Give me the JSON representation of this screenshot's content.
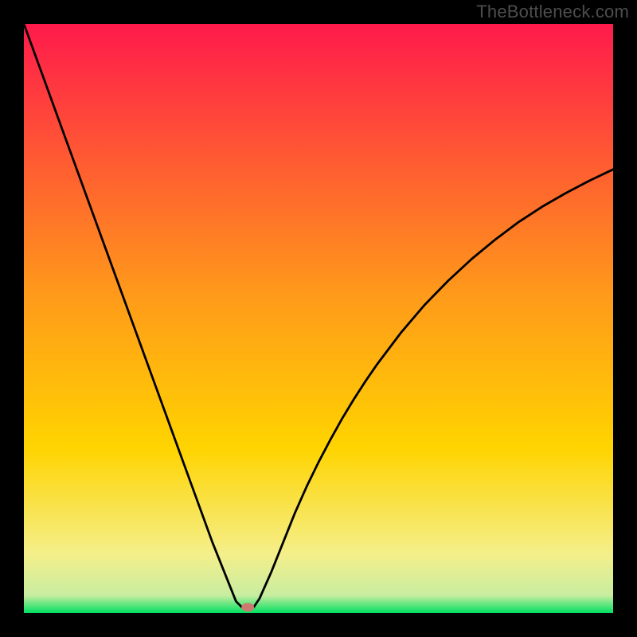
{
  "watermark": "TheBottleneck.com",
  "chart_data": {
    "type": "line",
    "title": "",
    "xlabel": "",
    "ylabel": "",
    "xlim": [
      0,
      100
    ],
    "ylim": [
      0,
      100
    ],
    "grid": false,
    "background_gradient": {
      "top": "#ff1a4b",
      "middle": "#ffd400",
      "bottom": "#00e060"
    },
    "marker": {
      "x": 38,
      "y": 1,
      "color": "#cc7a70"
    },
    "series": [
      {
        "name": "bottleneck-curve",
        "x": [
          0,
          2,
          4,
          6,
          8,
          10,
          12,
          14,
          16,
          18,
          20,
          22,
          24,
          26,
          28,
          30,
          32,
          34,
          35,
          36,
          37,
          38,
          39,
          40,
          42,
          44,
          46,
          48,
          50,
          52,
          54,
          56,
          58,
          60,
          64,
          68,
          72,
          76,
          80,
          84,
          88,
          92,
          96,
          100
        ],
        "y": [
          100,
          94.5,
          89,
          83.5,
          78,
          72.5,
          67,
          61.5,
          56,
          50.5,
          45,
          39.5,
          34,
          28.5,
          23,
          17.5,
          12,
          7,
          4.5,
          2,
          1,
          0.5,
          1,
          2.5,
          7,
          12,
          17,
          21.5,
          25.6,
          29.4,
          33,
          36.3,
          39.4,
          42.3,
          47.6,
          52.3,
          56.4,
          60.1,
          63.4,
          66.4,
          69,
          71.3,
          73.4,
          75.3
        ]
      }
    ]
  }
}
